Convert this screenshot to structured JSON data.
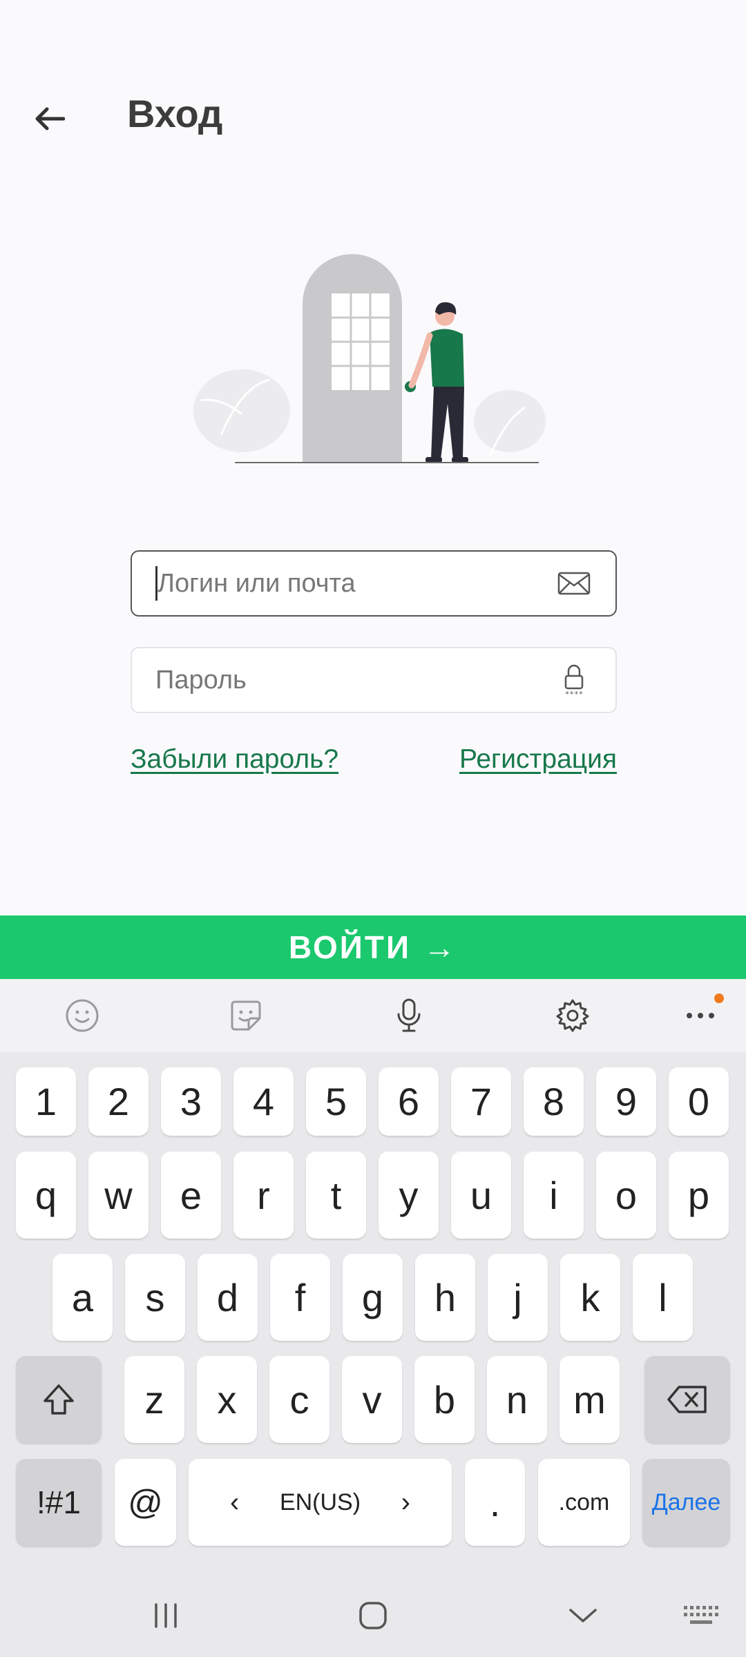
{
  "header": {
    "title": "Вход"
  },
  "form": {
    "login_placeholder": "Логин или почта",
    "password_placeholder": "Пароль",
    "forgot_link": "Забыли пароль?",
    "register_link": "Регистрация",
    "submit_label": "ВОЙТИ",
    "submit_arrow": "→"
  },
  "keyboard": {
    "row_numbers": [
      "1",
      "2",
      "3",
      "4",
      "5",
      "6",
      "7",
      "8",
      "9",
      "0"
    ],
    "row_1": [
      "q",
      "w",
      "e",
      "r",
      "t",
      "y",
      "u",
      "i",
      "o",
      "p"
    ],
    "row_2": [
      "a",
      "s",
      "d",
      "f",
      "g",
      "h",
      "j",
      "k",
      "l"
    ],
    "row_3": [
      "z",
      "x",
      "c",
      "v",
      "b",
      "n",
      "m"
    ],
    "symbols_key": "!#1",
    "at_key": "@",
    "language": "EN(US)",
    "lang_left": "‹",
    "lang_right": "›",
    "period_key": ".",
    "com_key": ".com",
    "action_key": "Далее"
  },
  "colors": {
    "accent_green": "#1bc86e",
    "link_green": "#17784b",
    "notification_dot": "#f07a1e",
    "action_blue": "#1a73e8"
  }
}
